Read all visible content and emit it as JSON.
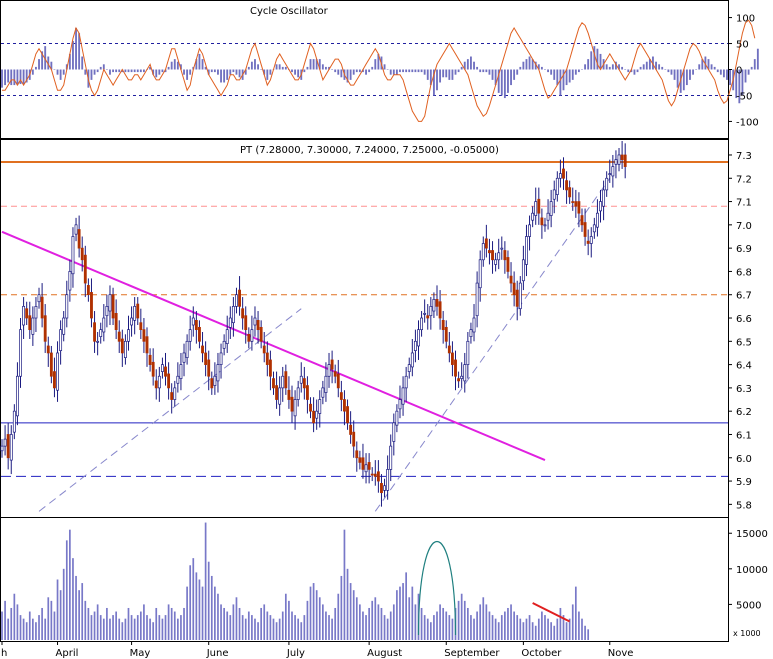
{
  "chart_data": [
    {
      "panel": "oscillator",
      "type": "bar+line",
      "title": "Cycle Oscillator",
      "yticks": [
        100,
        50,
        0,
        -50,
        -100
      ],
      "ylim": [
        -130,
        130
      ],
      "levels": [
        50,
        -50
      ],
      "xlim": [
        0,
        235
      ],
      "histogram": [
        -35,
        -30,
        -25,
        -30,
        -30,
        -30,
        -28,
        -28,
        -25,
        -20,
        -10,
        5,
        20,
        35,
        45,
        25,
        15,
        0,
        -10,
        -20,
        -10,
        10,
        30,
        55,
        80,
        70,
        25,
        -10,
        -35,
        -20,
        -10,
        -5,
        5,
        10,
        0,
        -10,
        -5,
        -5,
        -5,
        -5,
        -5,
        -5,
        -5,
        -5,
        -5,
        -5,
        -5,
        0,
        5,
        -10,
        -15,
        -10,
        -5,
        -5,
        5,
        15,
        20,
        15,
        10,
        -10,
        -20,
        -10,
        5,
        20,
        30,
        20,
        5,
        -10,
        -5,
        -5,
        -10,
        -25,
        -25,
        -20,
        -10,
        -5,
        -10,
        -15,
        -20,
        -10,
        5,
        15,
        20,
        10,
        0,
        -10,
        -20,
        -10,
        0,
        10,
        10,
        5,
        5,
        0,
        -5,
        -10,
        -15,
        -20,
        -5,
        5,
        20,
        20,
        20,
        20,
        10,
        5,
        5,
        0,
        -5,
        -10,
        -15,
        -20,
        -25,
        -20,
        -10,
        -5,
        -5,
        -5,
        -10,
        -5,
        5,
        20,
        30,
        25,
        10,
        0,
        -10,
        -10,
        -10,
        -5,
        -5,
        -5,
        -5,
        -5,
        -5,
        -5,
        -5,
        -10,
        -20,
        -30,
        -50,
        -40,
        -25,
        -15,
        -15,
        -20,
        -20,
        -10,
        -5,
        5,
        15,
        20,
        25,
        15,
        5,
        -5,
        -5,
        -5,
        -10,
        -20,
        -30,
        -45,
        -50,
        -55,
        -45,
        -30,
        -20,
        -10,
        5,
        15,
        20,
        25,
        20,
        15,
        10,
        5,
        0,
        -5,
        -10,
        -20,
        -30,
        -50,
        -40,
        -30,
        -25,
        -20,
        -10,
        -5,
        0,
        10,
        20,
        35,
        45,
        40,
        30,
        20,
        10,
        5,
        10,
        15,
        10,
        5,
        0,
        -5,
        -5,
        -10,
        -5,
        5,
        10,
        15,
        20,
        25,
        15,
        10,
        5,
        0,
        -5,
        -10,
        -20,
        -35,
        -45,
        -40,
        -30,
        -20,
        -10,
        0,
        10,
        20,
        25,
        20,
        10,
        5,
        -5,
        -10,
        -15,
        -20,
        -30,
        -40,
        -55,
        -65,
        -50,
        -25,
        -10,
        5,
        20,
        40
      ],
      "line": [
        -40,
        -40,
        -30,
        -20,
        -20,
        -30,
        -20,
        -30,
        -20,
        -10,
        10,
        30,
        40,
        30,
        20,
        10,
        0,
        -20,
        -40,
        -40,
        -30,
        0,
        30,
        60,
        80,
        70,
        40,
        10,
        -20,
        -40,
        -50,
        -40,
        -20,
        0,
        -10,
        -20,
        -30,
        -20,
        -10,
        0,
        -10,
        -20,
        -20,
        -10,
        -10,
        -20,
        -10,
        0,
        10,
        -10,
        -20,
        -20,
        -10,
        0,
        20,
        40,
        40,
        20,
        0,
        -20,
        -40,
        -30,
        0,
        20,
        40,
        30,
        10,
        -10,
        -20,
        -30,
        -40,
        -50,
        -40,
        -30,
        -10,
        -10,
        -20,
        -20,
        -10,
        0,
        20,
        40,
        50,
        30,
        10,
        -10,
        -30,
        -20,
        0,
        20,
        30,
        20,
        10,
        0,
        -10,
        -20,
        -20,
        -10,
        10,
        30,
        50,
        40,
        20,
        0,
        -20,
        -10,
        0,
        10,
        20,
        20,
        10,
        -10,
        -20,
        -30,
        -30,
        -20,
        -10,
        0,
        10,
        20,
        30,
        40,
        30,
        10,
        -10,
        -20,
        -20,
        -10,
        -10,
        -10,
        -20,
        -40,
        -60,
        -80,
        -90,
        -100,
        -100,
        -90,
        -60,
        -30,
        -10,
        10,
        20,
        30,
        40,
        50,
        40,
        30,
        20,
        10,
        0,
        -10,
        -30,
        -50,
        -70,
        -80,
        -90,
        -85,
        -70,
        -50,
        -30,
        -10,
        10,
        30,
        50,
        70,
        80,
        70,
        60,
        50,
        40,
        30,
        20,
        10,
        0,
        -20,
        -40,
        -55,
        -50,
        -40,
        -30,
        -20,
        -10,
        0,
        20,
        40,
        60,
        80,
        90,
        85,
        70,
        50,
        30,
        10,
        0,
        10,
        20,
        30,
        20,
        10,
        0,
        -10,
        -20,
        -10,
        0,
        20,
        40,
        50,
        40,
        30,
        20,
        10,
        0,
        -10,
        -20,
        -40,
        -60,
        -70,
        -60,
        -40,
        -20,
        0,
        20,
        40,
        50,
        45,
        35,
        20,
        10,
        0,
        -10,
        -20,
        -40,
        -55,
        -65,
        -60,
        -40,
        -20,
        10,
        40,
        70,
        90,
        95,
        85,
        60
      ],
      "series_name": "Cycle Oscillator"
    },
    {
      "panel": "price",
      "type": "candlestick",
      "title": "PT (7.28000, 7.30000, 7.24000, 7.25000, -0.05000)",
      "yticks": [
        7.3,
        7.2,
        7.1,
        7.0,
        6.9,
        6.8,
        6.7,
        6.6,
        6.5,
        6.4,
        6.3,
        6.2,
        6.1,
        6.0,
        5.9,
        5.8
      ],
      "ylim": [
        5.75,
        7.36
      ],
      "xlim": [
        0,
        235
      ],
      "closes": [
        6.05,
        6.08,
        6.0,
        6.1,
        6.2,
        6.35,
        6.55,
        6.65,
        6.6,
        6.55,
        6.6,
        6.65,
        6.7,
        6.6,
        6.5,
        6.45,
        6.35,
        6.3,
        6.45,
        6.55,
        6.6,
        6.7,
        6.8,
        6.95,
        7.0,
        6.9,
        6.85,
        6.75,
        6.7,
        6.6,
        6.5,
        6.5,
        6.55,
        6.6,
        6.65,
        6.7,
        6.6,
        6.55,
        6.5,
        6.45,
        6.5,
        6.55,
        6.6,
        6.65,
        6.6,
        6.55,
        6.5,
        6.45,
        6.4,
        6.35,
        6.3,
        6.35,
        6.4,
        6.35,
        6.3,
        6.25,
        6.3,
        6.35,
        6.4,
        6.45,
        6.5,
        6.55,
        6.6,
        6.55,
        6.5,
        6.45,
        6.4,
        6.35,
        6.3,
        6.35,
        6.4,
        6.45,
        6.5,
        6.55,
        6.6,
        6.65,
        6.7,
        6.65,
        6.6,
        6.55,
        6.5,
        6.55,
        6.6,
        6.55,
        6.5,
        6.45,
        6.4,
        6.35,
        6.3,
        6.25,
        6.3,
        6.35,
        6.3,
        6.25,
        6.2,
        6.25,
        6.3,
        6.35,
        6.3,
        6.25,
        6.2,
        6.15,
        6.2,
        6.25,
        6.3,
        6.35,
        6.4,
        6.38,
        6.35,
        6.3,
        6.25,
        6.2,
        6.15,
        6.1,
        6.05,
        6.0,
        5.98,
        5.95,
        5.97,
        5.95,
        5.93,
        5.92,
        5.9,
        5.85,
        5.88,
        5.95,
        6.05,
        6.15,
        6.2,
        6.25,
        6.3,
        6.35,
        6.4,
        6.45,
        6.5,
        6.55,
        6.6,
        6.62,
        6.6,
        6.65,
        6.68,
        6.65,
        6.6,
        6.55,
        6.5,
        6.45,
        6.4,
        6.35,
        6.33,
        6.35,
        6.4,
        6.5,
        6.55,
        6.6,
        6.75,
        6.85,
        6.92,
        6.9,
        6.88,
        6.85,
        6.85,
        6.88,
        6.9,
        6.85,
        6.8,
        6.75,
        6.7,
        6.65,
        6.75,
        6.85,
        6.95,
        7.0,
        7.05,
        7.1,
        7.05,
        7.0,
        7.0,
        7.05,
        7.1,
        7.15,
        7.2,
        7.22,
        7.2,
        7.15,
        7.12,
        7.1,
        7.08,
        7.05,
        7.0,
        6.95,
        6.92,
        6.95,
        7.0,
        7.05,
        7.1,
        7.15,
        7.2,
        7.22,
        7.25,
        7.28,
        7.3,
        7.28,
        7.25
      ],
      "lines": [
        {
          "kind": "resistance",
          "color": "#e07020",
          "y": 7.27
        },
        {
          "kind": "dashed-level",
          "color": "#ff9090",
          "y": 7.08
        },
        {
          "kind": "dashed-level",
          "color": "#e07020",
          "y": 6.7
        },
        {
          "kind": "support",
          "color": "#2020c0",
          "y": 6.15
        },
        {
          "kind": "support-dashed",
          "color": "#2020c0",
          "y": 5.92
        },
        {
          "kind": "downtrend",
          "color": "#e020e0",
          "from": [
            0,
            6.97
          ],
          "to": [
            176,
            5.99
          ]
        },
        {
          "kind": "uptrend",
          "color": "#8888cc",
          "from": [
            12,
            5.77
          ],
          "to": [
            97,
            6.64
          ]
        },
        {
          "kind": "uptrend",
          "color": "#8888cc",
          "from": [
            121,
            5.77
          ],
          "to": [
            197,
            7.2
          ]
        }
      ]
    },
    {
      "panel": "volume",
      "type": "bar",
      "yticks": [
        15000,
        10000,
        5000
      ],
      "ylim": [
        0,
        17000
      ],
      "multiplier_label": "x 1000",
      "xlim": [
        0,
        235
      ],
      "xticks": [
        {
          "label": "h",
          "x": 0
        },
        {
          "label": "April",
          "x": 18
        },
        {
          "label": "May",
          "x": 42
        },
        {
          "label": "June",
          "x": 67
        },
        {
          "label": "July",
          "x": 93
        },
        {
          "label": "August",
          "x": 119
        },
        {
          "label": "September",
          "x": 144
        },
        {
          "label": "October",
          "x": 169
        },
        {
          "label": "Nove",
          "x": 197
        }
      ],
      "values": [
        4000,
        5500,
        3000,
        4500,
        6500,
        5000,
        3500,
        3000,
        2500,
        4000,
        3000,
        2500,
        3500,
        4500,
        3000,
        6000,
        5500,
        4000,
        8500,
        7000,
        10000,
        14000,
        15500,
        11500,
        9000,
        7000,
        8000,
        5500,
        4500,
        3500,
        4000,
        5000,
        3500,
        3000,
        4500,
        3000,
        3500,
        4000,
        3000,
        2500,
        3000,
        4500,
        3500,
        3000,
        3500,
        4000,
        5000,
        3500,
        3000,
        2500,
        4500,
        3500,
        3000,
        3500,
        5000,
        4500,
        4000,
        3000,
        3500,
        4500,
        7500,
        10500,
        11500,
        9500,
        8500,
        7500,
        16500,
        11000,
        9000,
        7500,
        6500,
        5000,
        4500,
        4000,
        3500,
        5000,
        6000,
        4500,
        3500,
        3000,
        4000,
        3500,
        3000,
        2500,
        4500,
        5000,
        4000,
        3500,
        3000,
        2500,
        3000,
        4000,
        6500,
        5500,
        4000,
        3500,
        3000,
        2500,
        3500,
        5500,
        7500,
        8000,
        7000,
        6000,
        5000,
        4000,
        3500,
        3000,
        4500,
        6500,
        9000,
        15500,
        10000,
        8000,
        7000,
        6000,
        5000,
        4000,
        3500,
        4500,
        5500,
        6000,
        5000,
        4500,
        3500,
        3000,
        4000,
        5000,
        7000,
        7500,
        8000,
        9500,
        6000,
        7500,
        5000,
        6500,
        4500,
        3500,
        3000,
        2500,
        3500,
        4000,
        5000,
        4500,
        4000,
        3500,
        3000,
        4500,
        5500,
        6500,
        5500,
        4500,
        3500,
        3000,
        4000,
        5000,
        6000,
        5000,
        4000,
        3500,
        3000,
        2500,
        3500,
        4000,
        4500,
        5000,
        4000,
        3500,
        3000,
        2500,
        3000,
        3500,
        2500,
        2000,
        3000,
        4000,
        3500,
        3000,
        2500,
        2000,
        3000,
        4500,
        3500,
        2500,
        3000,
        5000,
        7500,
        4000,
        3000,
        2000,
        1500
      ],
      "annotations": [
        {
          "kind": "arc",
          "color": "#208080",
          "center_x": 141,
          "width_bars": 12,
          "peak": 14000
        },
        {
          "kind": "down-arrow",
          "color": "#e02020",
          "from": [
            172,
            5200
          ],
          "to": [
            184,
            2600
          ]
        }
      ]
    }
  ],
  "colors": {
    "candle_up": "#ffffff",
    "candle_down": "#b03000",
    "candle_outline": "#1a1a80",
    "osc_bar": "#7070c0",
    "osc_line": "#e06020",
    "volume_bar": "#7878c8"
  }
}
